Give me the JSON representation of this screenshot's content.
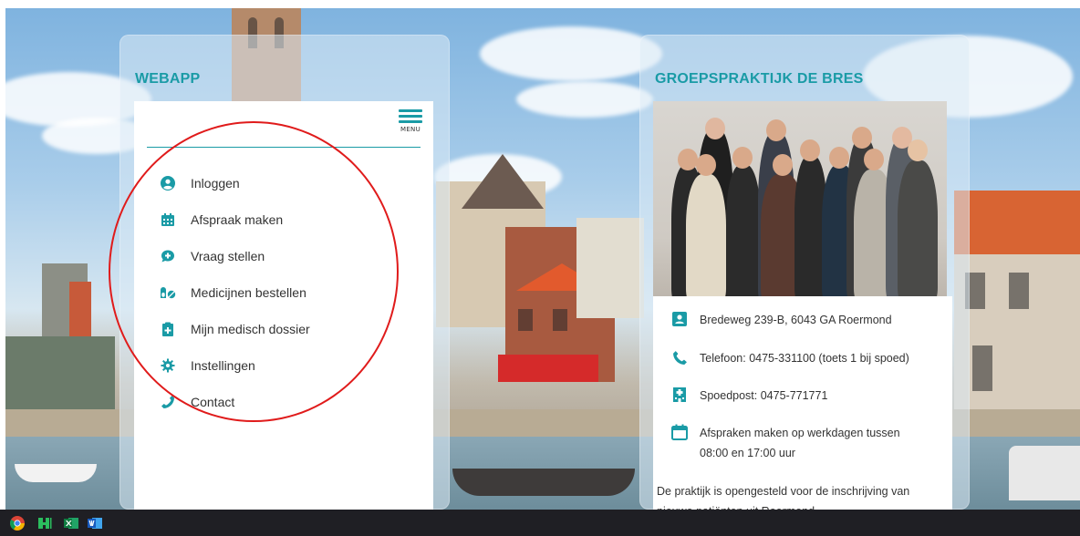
{
  "webapp": {
    "title": "WEBAPP",
    "menu_label": "MENU",
    "items": [
      {
        "label": "Inloggen",
        "icon": "user-circle-icon"
      },
      {
        "label": "Afspraak maken",
        "icon": "calendar-icon"
      },
      {
        "label": "Vraag stellen",
        "icon": "comment-plus-icon"
      },
      {
        "label": "Medicijnen bestellen",
        "icon": "pills-icon"
      },
      {
        "label": "Mijn medisch dossier",
        "icon": "medical-file-icon"
      },
      {
        "label": "Instellingen",
        "icon": "gear-icon"
      },
      {
        "label": "Contact",
        "icon": "phone-icon"
      }
    ]
  },
  "practice": {
    "title": "GROEPSPRAKTIJK DE BRES",
    "address": "Bredeweg 239-B, 6043 GA Roermond",
    "phone": "Telefoon: 0475-331100 (toets 1 bij spoed)",
    "emergency": "Spoedpost: 0475-771771",
    "hours_line1": "Afspraken maken op werkdagen tussen",
    "hours_line2": "08:00 en 17:00 uur",
    "description": "De praktijk is opengesteld voor de inschrijving van nieuwe patiënten uit Roermond."
  },
  "colors": {
    "accent": "#1a9ba6",
    "annotation": "#e01b1b",
    "taskbar": "#1f1f24"
  },
  "taskbar": {
    "icons": [
      "chrome-icon",
      "hyper-terminal-icon",
      "excel-icon",
      "word-icon"
    ]
  }
}
